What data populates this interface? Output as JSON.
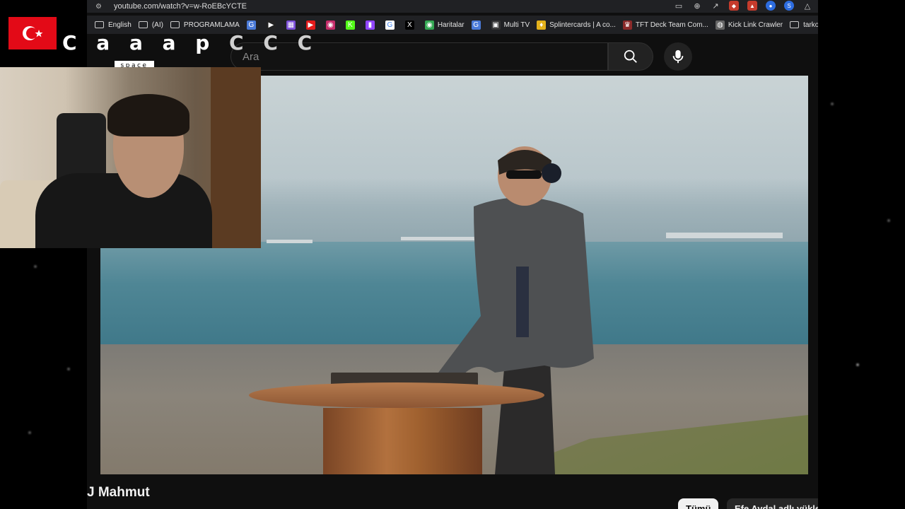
{
  "browser": {
    "url": "youtube.com/watch?v=w-RoEBcYCTE",
    "bookmarks": [
      {
        "label": "English",
        "icon": "folder-icon"
      },
      {
        "label": "(AI)",
        "icon": "folder-icon"
      },
      {
        "label": "PROGRAMLAMA",
        "icon": "folder-icon"
      },
      {
        "label": "",
        "icon": "translate-icon"
      },
      {
        "label": "",
        "icon": "play-icon"
      },
      {
        "label": "",
        "icon": "grid-icon"
      },
      {
        "label": "",
        "icon": "youtube-icon"
      },
      {
        "label": "",
        "icon": "app-icon"
      },
      {
        "label": "",
        "icon": "kick-icon"
      },
      {
        "label": "",
        "icon": "twitch-icon"
      },
      {
        "label": "",
        "icon": "google-icon"
      },
      {
        "label": "",
        "icon": "x-icon"
      },
      {
        "label": "Haritalar",
        "icon": "maps-icon"
      },
      {
        "label": "",
        "icon": "translate-icon"
      },
      {
        "label": "Multi TV",
        "icon": "tv-icon"
      },
      {
        "label": "Splintercards | A co...",
        "icon": "card-icon"
      },
      {
        "label": "TFT Deck Team Com...",
        "icon": "tft-icon"
      },
      {
        "label": "Kick Link Crawler",
        "icon": "globe-icon"
      },
      {
        "label": "tarkov",
        "icon": "folder-icon"
      }
    ]
  },
  "overlay": {
    "channel_name_main": "C a a a p",
    "channel_name_faded": "C C C",
    "space_tag": "space"
  },
  "youtube": {
    "search_placeholder": "Ara",
    "video_title": "J Mahmut",
    "chips": {
      "active": "Tümü",
      "other": "Efe Aydal adlı yükleyi"
    }
  },
  "colors": {
    "flag_red": "#e30a17",
    "page_bg": "#0f0f0f"
  }
}
